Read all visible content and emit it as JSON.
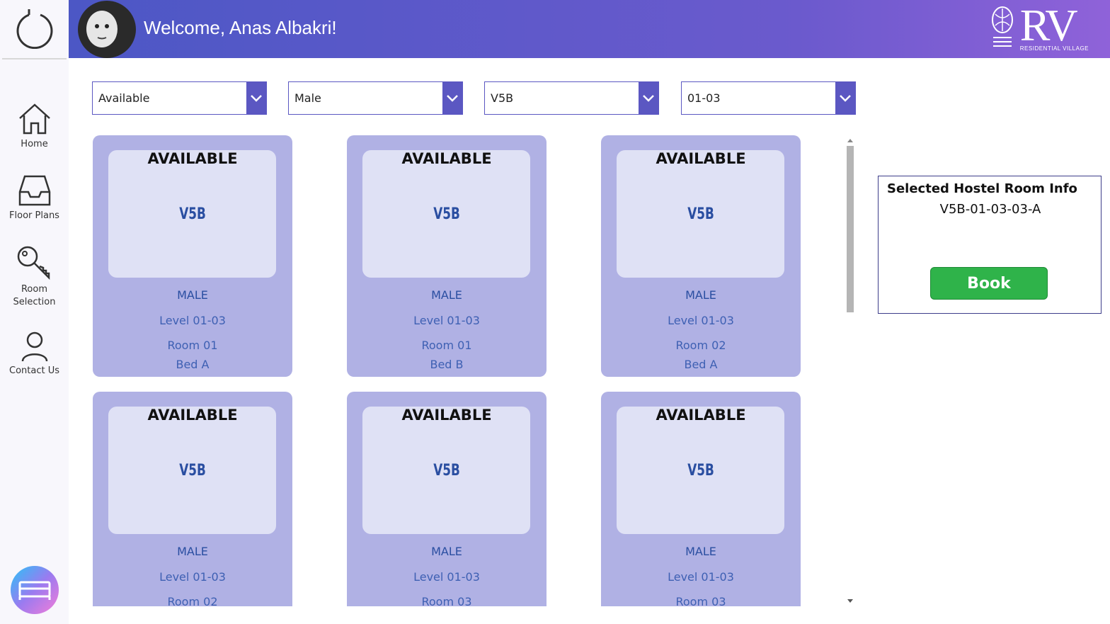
{
  "header": {
    "welcome": "Welcome, Anas Albakri!",
    "logo_text": "RV",
    "logo_subtitle": "RESIDENTIAL VILLAGE"
  },
  "sidebar": {
    "items": [
      {
        "label": "Home",
        "icon": "home-icon"
      },
      {
        "label": "Floor Plans",
        "icon": "inbox-icon"
      },
      {
        "label": "Room Selection",
        "icon": "key-icon"
      },
      {
        "label": "Contact Us",
        "icon": "person-icon"
      }
    ]
  },
  "filters": {
    "status": "Available",
    "gender": "Male",
    "block": "V5B",
    "level": "01-03"
  },
  "cards": [
    {
      "status": "AVAILABLE",
      "block": "V5B",
      "gender": "MALE",
      "level": "Level 01-03",
      "room": "Room 01",
      "bed": "Bed A"
    },
    {
      "status": "AVAILABLE",
      "block": "V5B",
      "gender": "MALE",
      "level": "Level 01-03",
      "room": "Room 01",
      "bed": "Bed B"
    },
    {
      "status": "AVAILABLE",
      "block": "V5B",
      "gender": "MALE",
      "level": "Level 01-03",
      "room": "Room 02",
      "bed": "Bed A"
    },
    {
      "status": "AVAILABLE",
      "block": "V5B",
      "gender": "MALE",
      "level": "Level 01-03",
      "room": "Room 02",
      "bed": ""
    },
    {
      "status": "AVAILABLE",
      "block": "V5B",
      "gender": "MALE",
      "level": "Level 01-03",
      "room": "Room 03",
      "bed": ""
    },
    {
      "status": "AVAILABLE",
      "block": "V5B",
      "gender": "MALE",
      "level": "Level 01-03",
      "room": "Room 03",
      "bed": ""
    }
  ],
  "info_panel": {
    "title": "Selected Hostel Room Info",
    "value": "V5B-01-03-03-A",
    "book_label": "Book"
  },
  "colors": {
    "accent": "#5b57c2",
    "card_bg": "#b0b1e4",
    "book_green": "#2fb34a"
  }
}
